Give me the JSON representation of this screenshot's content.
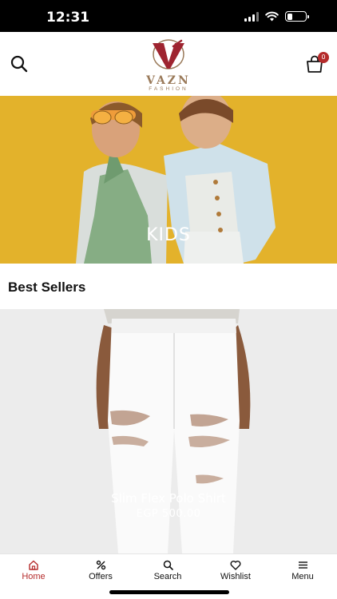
{
  "status_bar": {
    "time": "12:31",
    "battery_level": 0.3
  },
  "header": {
    "logo_text": "VAZN",
    "logo_subtext": "FASHION",
    "cart_count": "0",
    "icons": {
      "search": "search-icon",
      "cart": "shopping-bag-icon"
    }
  },
  "banner": {
    "label": "KIDS"
  },
  "best_sellers": {
    "title": "Best Sellers",
    "product": {
      "name": "Slim Flex Polo Shirt",
      "price": "EGP 500.00"
    }
  },
  "tab_bar": {
    "items": [
      {
        "label": "Home",
        "icon": "home-icon",
        "active": true
      },
      {
        "label": "Offers",
        "icon": "percent-icon",
        "active": false
      },
      {
        "label": "Search",
        "icon": "search-icon",
        "active": false
      },
      {
        "label": "Wishlist",
        "icon": "heart-icon",
        "active": false
      },
      {
        "label": "Menu",
        "icon": "menu-icon",
        "active": false
      }
    ]
  },
  "colors": {
    "accent": "#b52b2b",
    "banner_bg": "#e3b22b",
    "logo_gold": "#9a7a5a"
  }
}
